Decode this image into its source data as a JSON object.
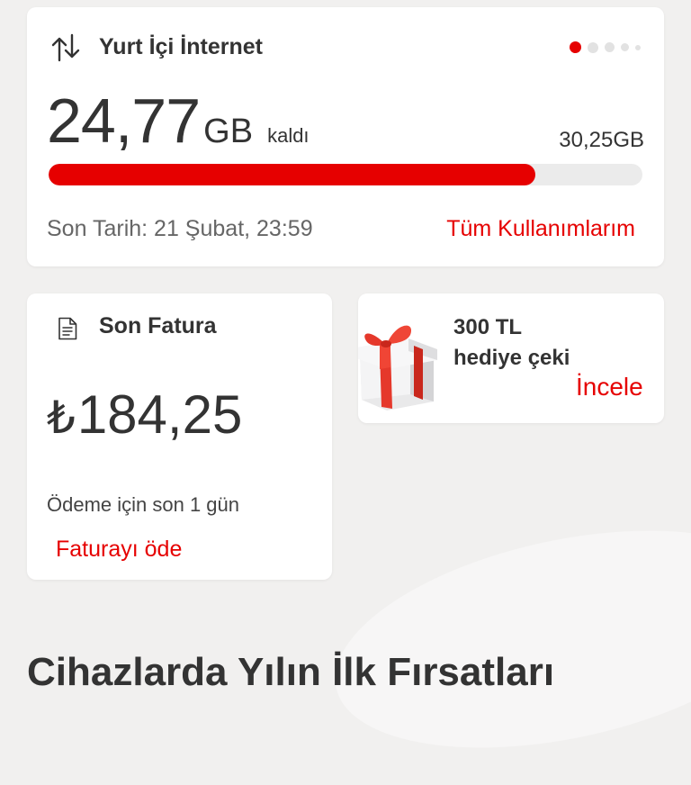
{
  "colors": {
    "accent": "#e60000",
    "background": "#f1f0ef",
    "card": "#ffffff",
    "track": "#ebebeb"
  },
  "internet": {
    "icon": "data-transfer-icon",
    "title": "Yurt İçi İnternet",
    "remaining_value": "24,77",
    "remaining_unit": "GB",
    "remaining_label": "kaldı",
    "total": "30,25GB",
    "usage_fraction": 0.819,
    "expiry": "Son Tarih: 21 Şubat, 23:59",
    "all_usage_link": "Tüm Kullanımlarım",
    "carousel": {
      "count": 5,
      "active_index": 0
    }
  },
  "invoice": {
    "icon": "document-icon",
    "title": "Son Fatura",
    "currency_symbol": "₺",
    "amount": "184,25",
    "due_text": "Ödeme için son 1 gün",
    "pay_link": "Faturayı öde"
  },
  "gift": {
    "icon": "gift-box-icon",
    "amount": "300 TL",
    "text": "hediye çeki",
    "link": "İncele"
  },
  "section": {
    "title": "Cihazlarda Yılın İlk Fırsatları"
  }
}
